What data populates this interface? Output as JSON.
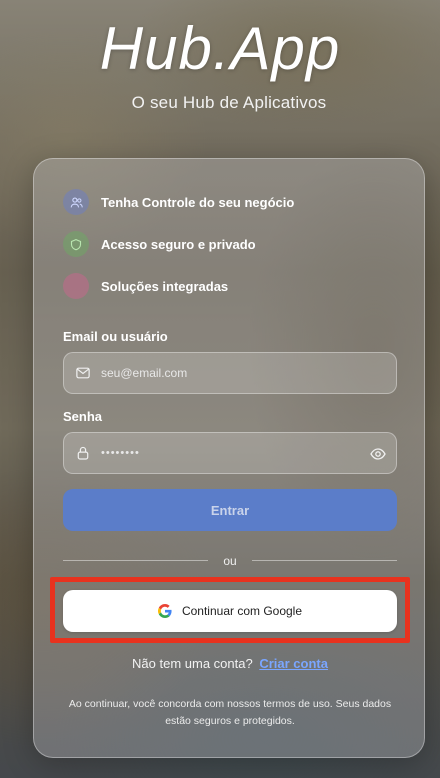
{
  "header": {
    "logo": "Hub.App",
    "tagline": "O seu Hub de Aplicativos"
  },
  "features": [
    {
      "label": "Tenha Controle do seu negócio",
      "icon": "users-icon",
      "color": "#6f7fc0"
    },
    {
      "label": "Acesso seguro e privado",
      "icon": "shield-icon",
      "color": "#6fa866"
    },
    {
      "label": "Soluções integradas",
      "icon": "puzzle-icon",
      "color": "#c06b8a"
    }
  ],
  "form": {
    "email_label": "Email ou usuário",
    "email_placeholder": "seu@email.com",
    "password_label": "Senha",
    "password_value": "••••••••",
    "submit_label": "Entrar",
    "divider": "ou",
    "google_label": "Continuar com Google"
  },
  "signup": {
    "prompt": "Não tem uma conta?",
    "link": "Criar conta"
  },
  "terms": "Ao continuar, você concorda com nossos termos de uso. Seus dados estão seguros e protegidos.",
  "colors": {
    "accent": "#5b7dc9",
    "link": "#7aa6ff",
    "highlight": "#e8321e"
  }
}
